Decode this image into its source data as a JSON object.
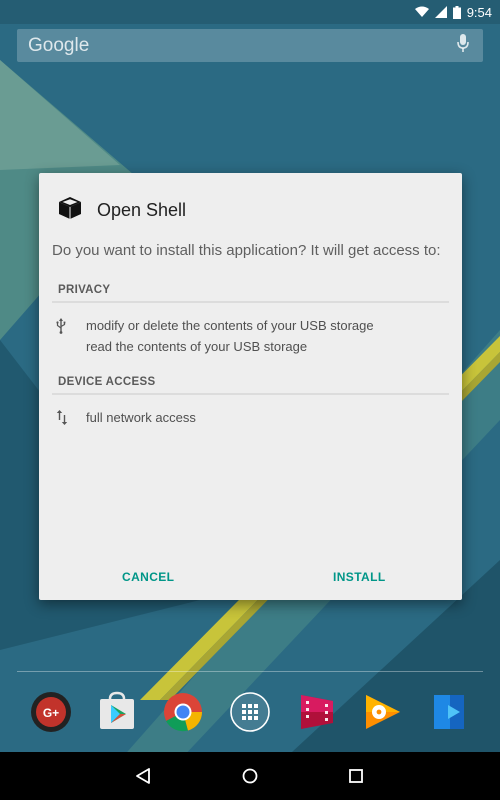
{
  "status_bar": {
    "time": "9:54",
    "icons": [
      "wifi-icon",
      "signal-icon",
      "battery-icon"
    ]
  },
  "search_bar": {
    "logo": "Google",
    "mic_icon": "mic-icon"
  },
  "dialog": {
    "app_icon": "cube-icon",
    "title": "Open Shell",
    "prompt": "Do you want to install this application? It will get access to:",
    "sections": [
      {
        "heading": "PRIVACY",
        "icon": "usb-icon",
        "permissions": [
          "modify or delete the contents of your USB storage",
          "read the contents of your USB storage"
        ]
      },
      {
        "heading": "DEVICE ACCESS",
        "icon": "network-arrows-icon",
        "permissions": [
          "full network access"
        ]
      }
    ],
    "cancel_label": "CANCEL",
    "install_label": "INSTALL",
    "accent_color": "#009688"
  },
  "dock": {
    "apps": [
      "google-plus-icon",
      "play-store-icon",
      "chrome-icon",
      "app-drawer-icon",
      "play-movies-icon",
      "play-music-icon",
      "play-books-icon"
    ]
  },
  "nav_bar": {
    "buttons": [
      "back-icon",
      "home-icon",
      "recents-icon"
    ]
  }
}
